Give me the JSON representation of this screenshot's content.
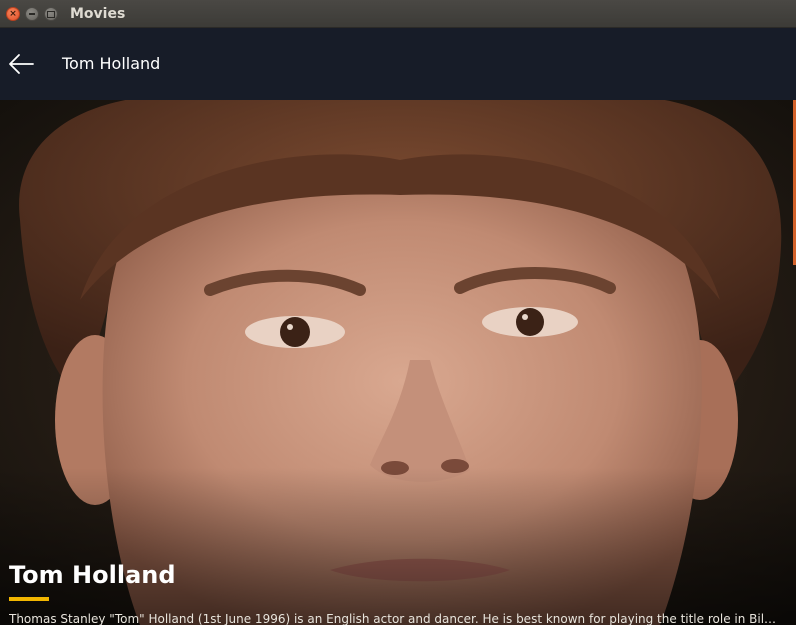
{
  "window": {
    "title": "Movies"
  },
  "header": {
    "title": "Tom Holland"
  },
  "person": {
    "name": "Tom Holland",
    "bio": "Thomas Stanley \"Tom\" Holland (1st June 1996) is an English actor and dancer. He is best known for playing the title role in Billy Elli..."
  },
  "colors": {
    "appbar": "#171c28",
    "accent_underline": "#f2b600",
    "scroll_accent": "#d4622a"
  },
  "icons": {
    "back": "arrow-left-icon"
  }
}
